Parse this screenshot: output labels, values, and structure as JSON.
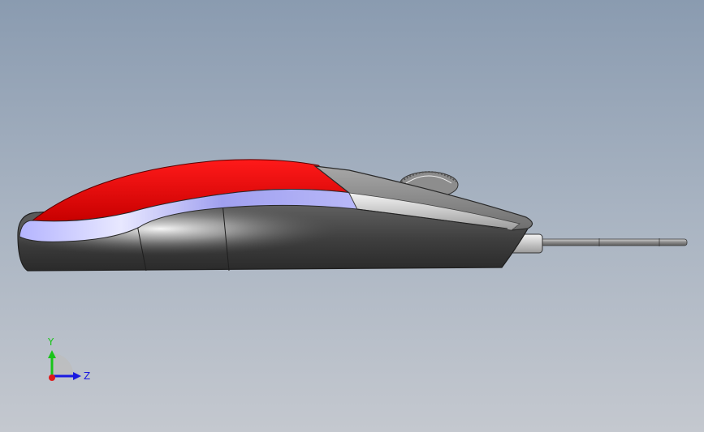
{
  "viewport": {
    "background_top": "#8a9bb0",
    "background_bottom": "#c4c8cf"
  },
  "model": {
    "shell_color": "#e00000",
    "accent_band_color": "#a9a9f5",
    "body_color": "#4a4a4a",
    "button_color": "#8c8c8c",
    "wheel_color": "#9a9a9a",
    "cable_color": "#9a9a9a"
  },
  "triad": {
    "y_label": "Y",
    "z_label": "Z",
    "y_color": "#19c419",
    "z_color": "#1a1ae0",
    "x_color": "#e01a1a"
  }
}
